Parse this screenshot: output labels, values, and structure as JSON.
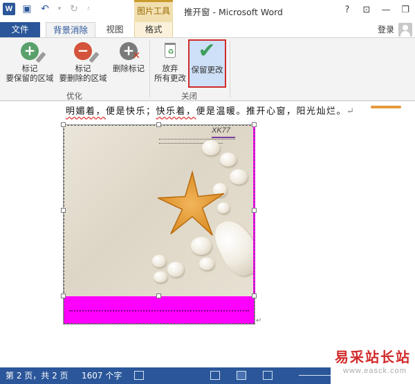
{
  "titlebar": {
    "app_logo": "W",
    "contextual_group": "图片工具",
    "document_title": "推开窗 - Microsoft Word",
    "help": "?",
    "restore_ribbon": "⊡",
    "minimize": "—",
    "restore": "❐"
  },
  "tabs": {
    "file": "文件",
    "background_removal": "背景消除",
    "view": "视图",
    "format": "格式",
    "login": "登录"
  },
  "ribbon": {
    "refine_group": "优化",
    "close_group": "关闭",
    "mark_keep_l1": "标记",
    "mark_keep_l2": "要保留的区域",
    "mark_remove_l1": "标记",
    "mark_remove_l2": "要删除的区域",
    "delete_mark": "删除标记",
    "discard_l1": "放弃",
    "discard_l2": "所有更改",
    "keep_changes": "保留更改"
  },
  "document": {
    "line_part1": "明媚着，",
    "line_part2": "便是快乐；",
    "line_part3": "快乐着，",
    "line_part4": "便是温暖。推开心窗，阳光灿烂。",
    "image_caption": "XK77"
  },
  "statusbar": {
    "page": "第 2 页，共 2 页",
    "words": "1607 个字"
  },
  "watermark": {
    "title": "易采站长站",
    "url": "www.easck.com"
  },
  "colors": {
    "word_blue": "#2b579a",
    "removal_magenta": "#ff00ff",
    "highlight_red": "#d12a2a"
  }
}
